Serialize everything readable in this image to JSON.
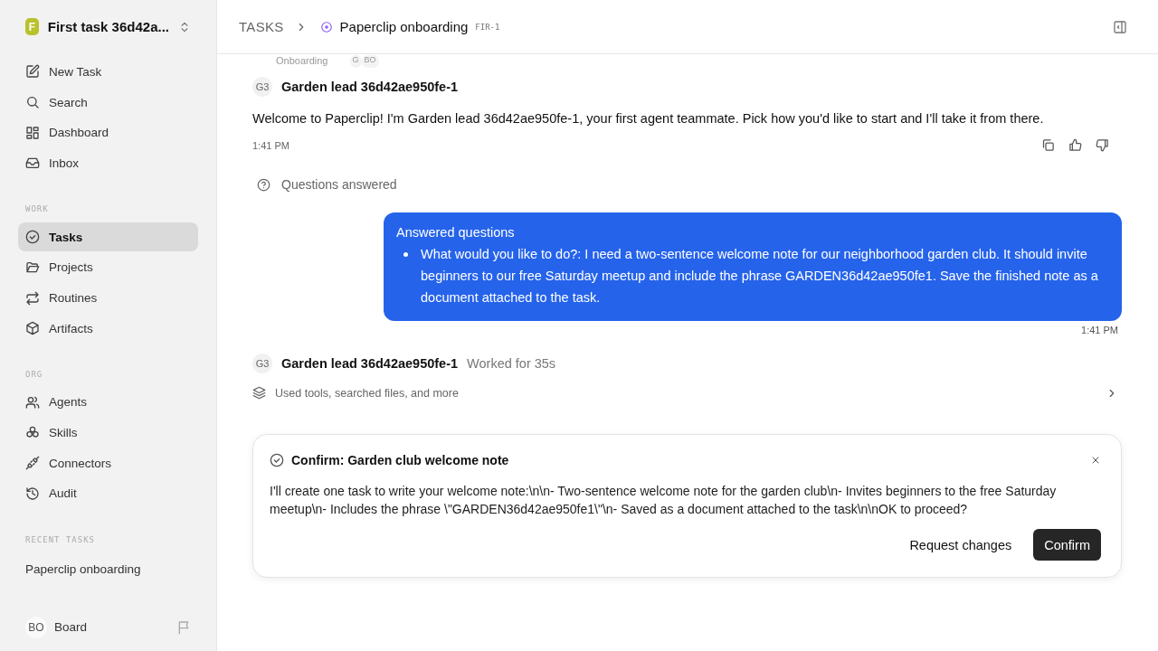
{
  "workspace": {
    "initial": "F",
    "name": "First task 36d42a..."
  },
  "nav": [
    {
      "label": "New Task",
      "selected": false
    },
    {
      "label": "Search",
      "selected": false
    },
    {
      "label": "Dashboard",
      "selected": false
    },
    {
      "label": "Inbox",
      "selected": false
    }
  ],
  "sections": [
    {
      "title": "WORK",
      "items": [
        {
          "label": "Tasks",
          "selected": true
        },
        {
          "label": "Projects",
          "selected": false
        },
        {
          "label": "Routines",
          "selected": false
        },
        {
          "label": "Artifacts",
          "selected": false
        }
      ]
    },
    {
      "title": "ORG",
      "items": [
        {
          "label": "Agents",
          "selected": false
        },
        {
          "label": "Skills",
          "selected": false
        },
        {
          "label": "Connectors",
          "selected": false
        },
        {
          "label": "Audit",
          "selected": false
        }
      ]
    }
  ],
  "recent": {
    "title": "RECENT TASKS",
    "items": [
      {
        "label": "Paperclip onboarding",
        "selected": false
      }
    ]
  },
  "user": {
    "initials": "BO",
    "name": "Board"
  },
  "breadcrumb": {
    "root": "TASKS",
    "title": "Paperclip onboarding",
    "id": "FIR-1"
  },
  "chips": {
    "project": "Onboarding",
    "avatars": [
      "G",
      "BO"
    ]
  },
  "messages": [
    {
      "kind": "agent",
      "avatar": "G3",
      "author": "Garden lead 36d42ae950fe-1",
      "text": "Welcome to Paperclip! I'm Garden lead 36d42ae950fe-1, your first agent teammate. Pick how you'd like to start and I'll take it from there.",
      "time": "1:41 PM"
    },
    {
      "kind": "event",
      "text": "Questions answered"
    },
    {
      "kind": "user",
      "title": "Answered questions",
      "bullets": [
        "What would you like to do?: I need a two-sentence welcome note for our neighborhood garden club. It should invite beginners to our free Saturday meetup and include the phrase GARDEN36d42ae950fe1. Save the finished note as a document attached to the task."
      ],
      "time": "1:41 PM"
    },
    {
      "kind": "work",
      "avatar": "G3",
      "author": "Garden lead 36d42ae950fe-1",
      "status": "Worked for 35s",
      "summary": "Used tools, searched files, and more"
    }
  ],
  "confirm": {
    "title": "Confirm: Garden club welcome note",
    "text": "I'll create one task to write your welcome note:\\n\\n- Two-sentence welcome note for the garden club\\n- Invites beginners to the free Saturday meetup\\n- Includes the phrase \\\"GARDEN36d42ae950fe1\\\"\\n- Saved as a document attached to the task\\n\\nOK to proceed?",
    "buttons": [
      "Request changes",
      "Confirm"
    ]
  }
}
